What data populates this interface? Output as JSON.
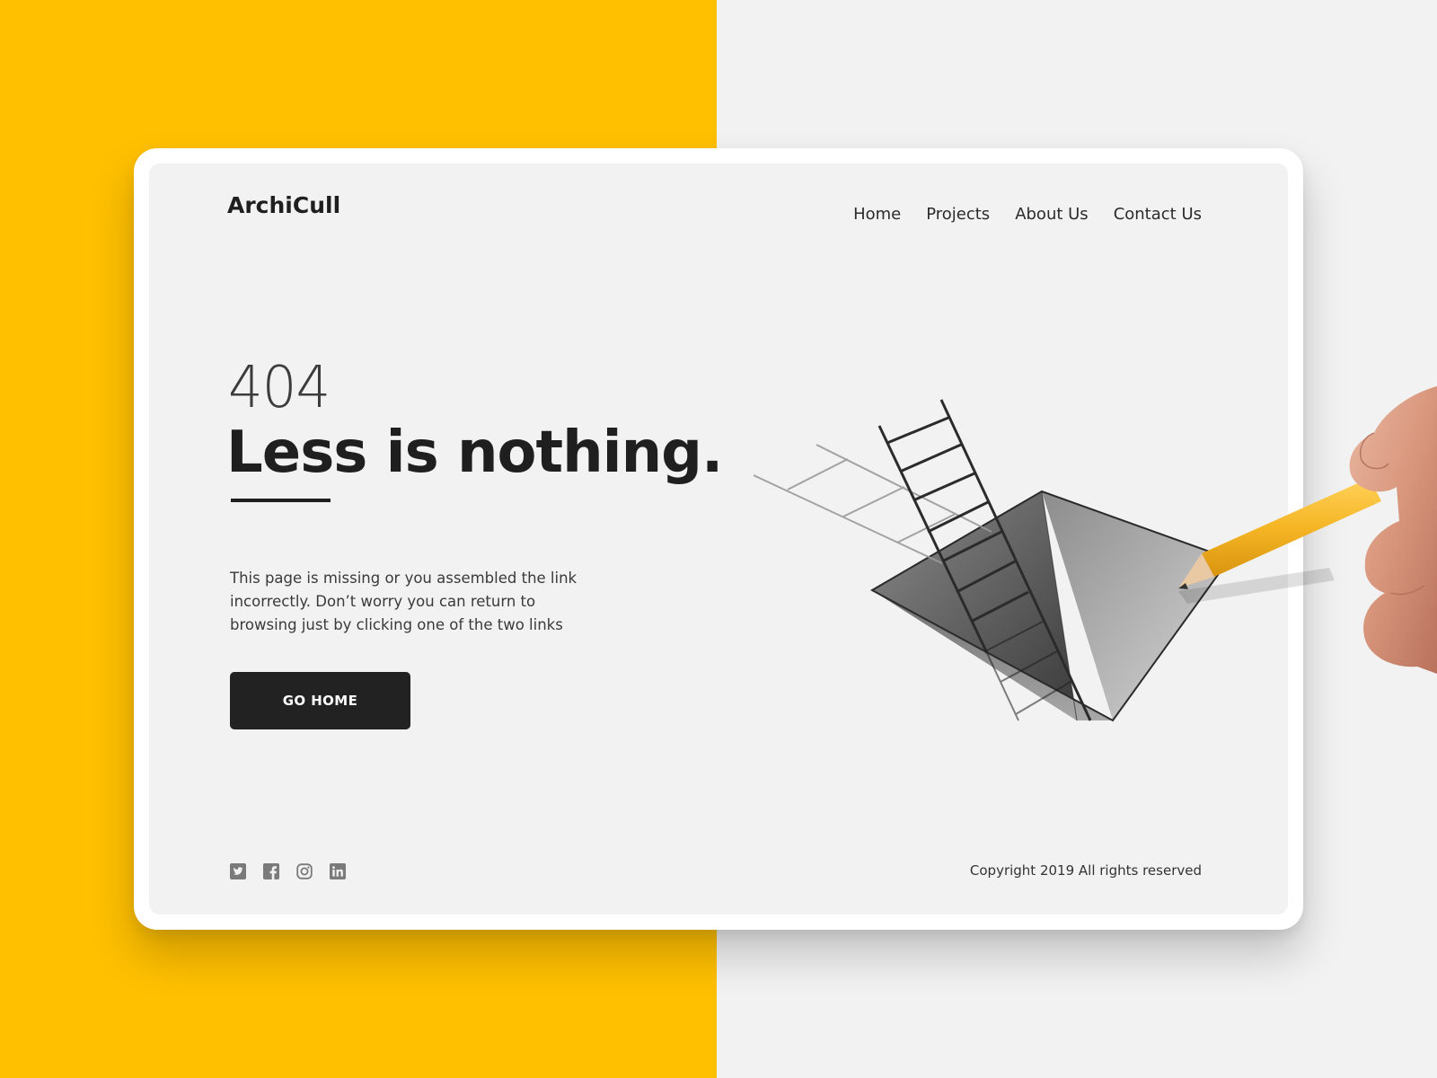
{
  "brand": {
    "name": "ArchiCull"
  },
  "nav": {
    "items": [
      {
        "label": "Home"
      },
      {
        "label": "Projects"
      },
      {
        "label": "About Us"
      },
      {
        "label": "Contact Us"
      }
    ]
  },
  "hero": {
    "code": "404",
    "headline": "Less is nothing.",
    "description": "This page is missing or you assembled the link incorrectly. Don’t worry you can return to browsing just by clicking one of the two links",
    "button_label": "GO HOME"
  },
  "footer": {
    "socials": [
      {
        "icon": "twitter-icon"
      },
      {
        "icon": "facebook-icon"
      },
      {
        "icon": "instagram-icon"
      },
      {
        "icon": "linkedin-icon"
      }
    ],
    "copyright": "Copyright 2019 All rights reserved"
  },
  "colors": {
    "accent_yellow": "#ffc000",
    "dark": "#222222",
    "screen_bg": "#f2f2f2",
    "icon_grey": "#7a7a7a"
  }
}
